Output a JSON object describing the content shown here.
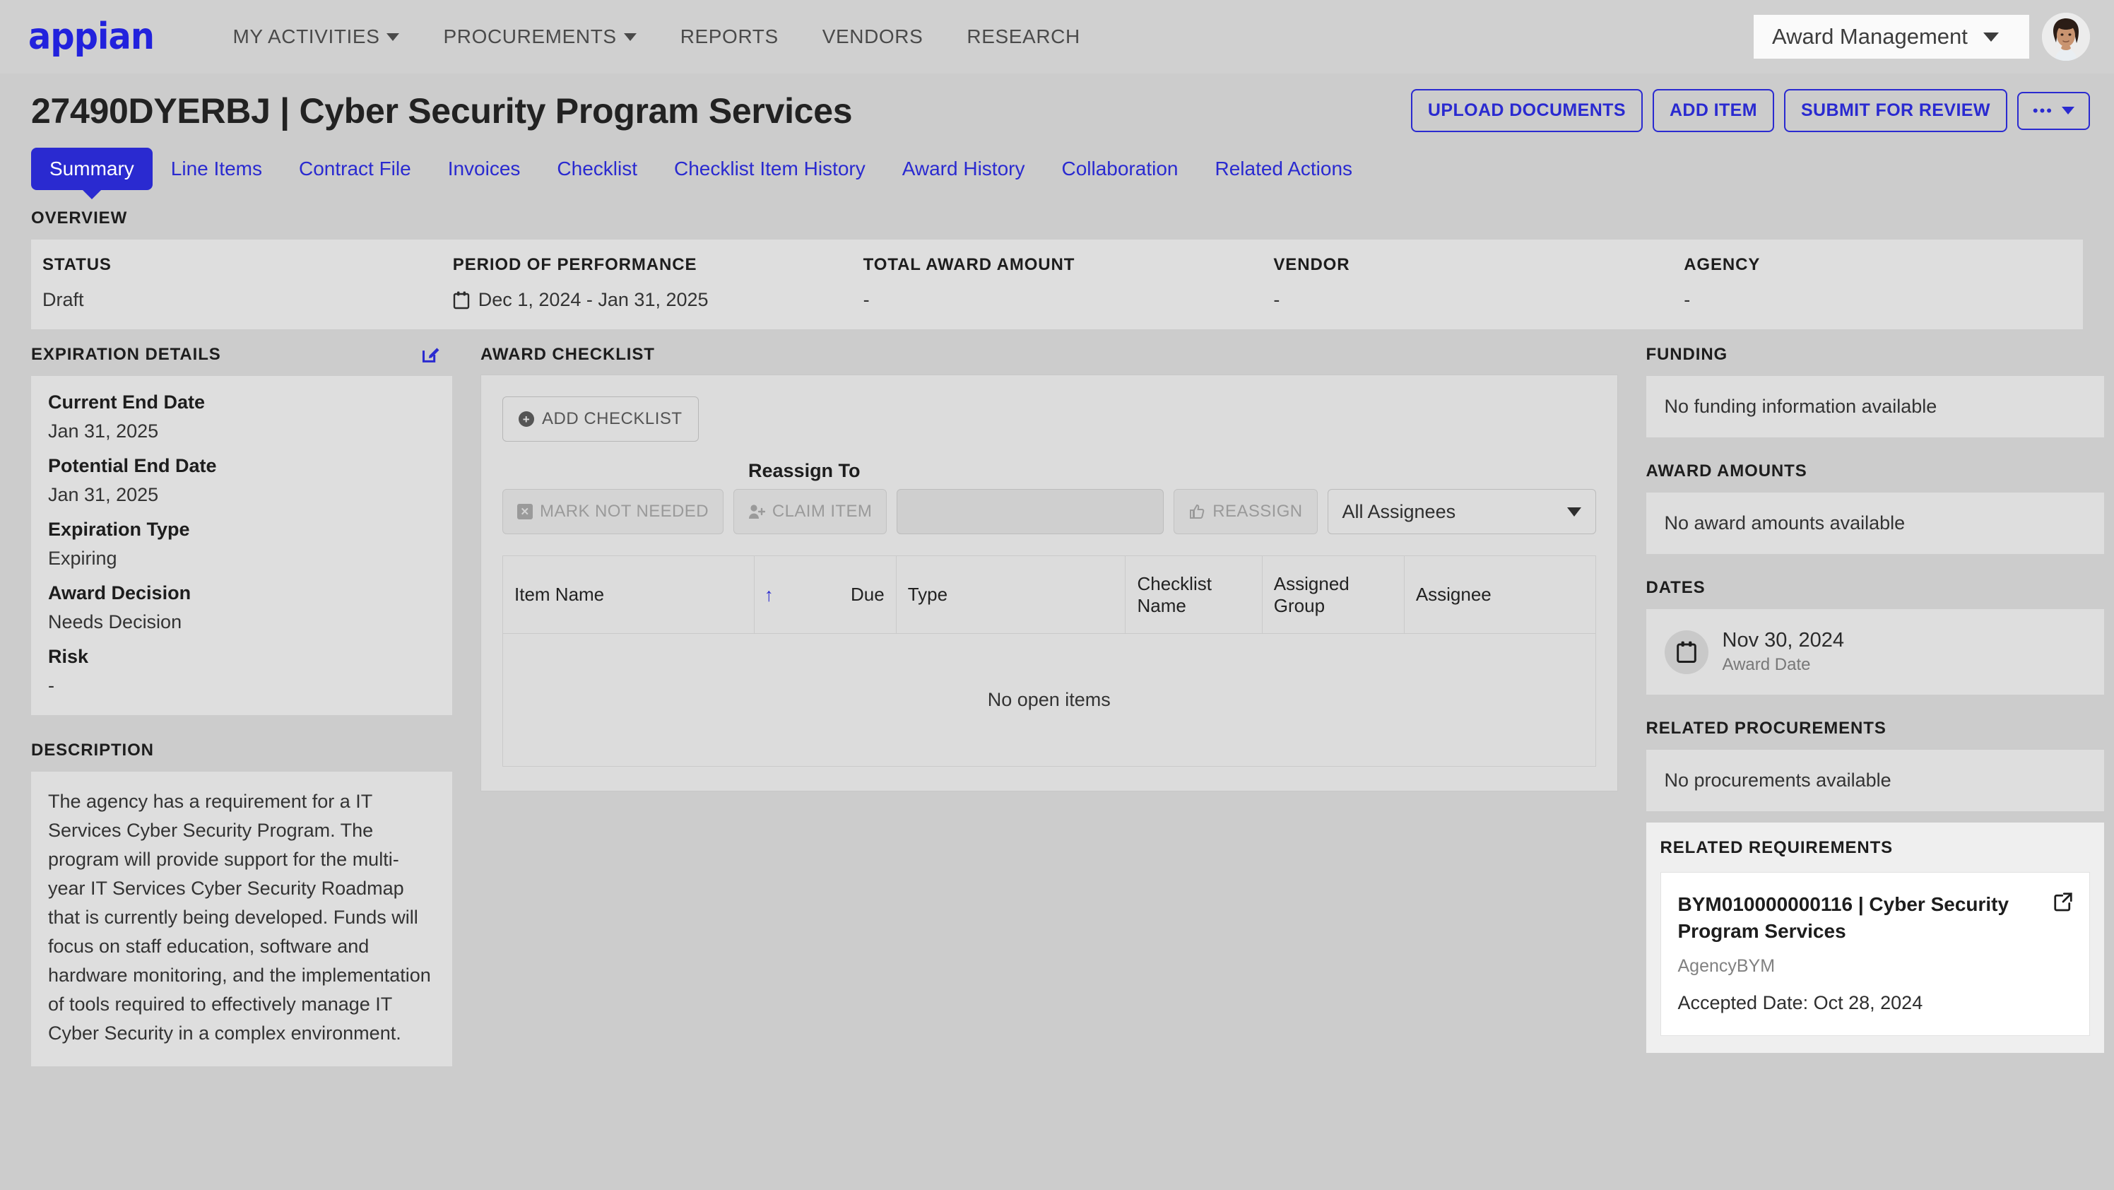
{
  "topnav": {
    "logo_text": "appian",
    "items": [
      {
        "label": "MY ACTIVITIES",
        "has_caret": true
      },
      {
        "label": "PROCUREMENTS",
        "has_caret": true
      },
      {
        "label": "REPORTS",
        "has_caret": false
      },
      {
        "label": "VENDORS",
        "has_caret": false
      },
      {
        "label": "RESEARCH",
        "has_caret": false
      }
    ],
    "context_selector": "Award Management"
  },
  "page": {
    "title": "27490DYERBJ | Cyber Security Program Services",
    "actions": [
      {
        "label": "UPLOAD DOCUMENTS"
      },
      {
        "label": "ADD ITEM"
      },
      {
        "label": "SUBMIT FOR REVIEW"
      }
    ],
    "kebab_label": "•••"
  },
  "tabs": [
    {
      "label": "Summary",
      "active": true
    },
    {
      "label": "Line Items",
      "active": false
    },
    {
      "label": "Contract File",
      "active": false
    },
    {
      "label": "Invoices",
      "active": false
    },
    {
      "label": "Checklist",
      "active": false
    },
    {
      "label": "Checklist Item History",
      "active": false
    },
    {
      "label": "Award History",
      "active": false
    },
    {
      "label": "Collaboration",
      "active": false
    },
    {
      "label": "Related Actions",
      "active": false
    }
  ],
  "overview": {
    "section_label": "OVERVIEW",
    "columns": [
      {
        "header": "STATUS",
        "value": "Draft",
        "icon": null
      },
      {
        "header": "PERIOD OF PERFORMANCE",
        "value": "Dec 1, 2024 - Jan 31, 2025",
        "icon": "calendar-icon"
      },
      {
        "header": "TOTAL AWARD AMOUNT",
        "value": "-",
        "icon": null
      },
      {
        "header": "VENDOR",
        "value": "-",
        "icon": null
      },
      {
        "header": "AGENCY",
        "value": "-",
        "icon": null
      }
    ]
  },
  "expiration": {
    "section_label": "EXPIRATION DETAILS",
    "edit_icon": "edit-pencil-icon",
    "fields": [
      {
        "label": "Current End Date",
        "value": "Jan 31, 2025"
      },
      {
        "label": "Potential End Date",
        "value": "Jan 31, 2025"
      },
      {
        "label": "Expiration Type",
        "value": "Expiring"
      },
      {
        "label": "Award Decision",
        "value": "Needs Decision"
      },
      {
        "label": "Risk",
        "value": "-"
      }
    ]
  },
  "description": {
    "section_label": "DESCRIPTION",
    "text": "The agency has a requirement for a IT Services Cyber Security Program. The program will provide support for the multi-year IT Services Cyber Security Roadmap that is currently being developed. Funds will focus on staff education, software and hardware monitoring, and the implementation of tools required to effectively manage IT Cyber Security in a complex environment."
  },
  "checklist": {
    "section_label": "AWARD CHECKLIST",
    "add_button": "ADD CHECKLIST",
    "reassign_label": "Reassign To",
    "reassign_input_value": "",
    "reassign_input_placeholder": "",
    "buttons": [
      {
        "label": "MARK NOT NEEDED",
        "icon": "x-square-icon",
        "disabled": true
      },
      {
        "label": "CLAIM ITEM",
        "icon": "user-add-icon",
        "disabled": true
      },
      {
        "label": "REASSIGN",
        "icon": "thumb-icon",
        "disabled": true
      }
    ],
    "assignee_filter": "All Assignees",
    "table": {
      "headers": [
        "Item Name",
        "Due",
        "Type",
        "Checklist Name",
        "Assigned Group",
        "Assignee"
      ],
      "sort_column": "Due",
      "sort_direction": "asc",
      "rows": [],
      "empty_message": "No open items"
    }
  },
  "rail": {
    "funding": {
      "label": "FUNDING",
      "empty": "No funding information available"
    },
    "award_amounts": {
      "label": "AWARD AMOUNTS",
      "empty": "No award amounts available"
    },
    "dates": {
      "label": "DATES",
      "items": [
        {
          "icon": "calendar-icon",
          "date": "Nov 30, 2024",
          "caption": "Award Date"
        }
      ]
    },
    "related_procurements": {
      "label": "RELATED PROCUREMENTS",
      "empty": "No procurements available"
    },
    "related_requirements": {
      "label": "RELATED REQUIREMENTS",
      "cards": [
        {
          "title": "BYM010000000116 | Cyber Security Program Services",
          "agency": "AgencyBYM",
          "accepted": "Accepted Date: Oct 28, 2024",
          "link_icon": "external-link-icon"
        }
      ]
    }
  },
  "colors": {
    "brand_blue": "#2a2ad0",
    "page_bg": "#cccccc",
    "panel_bg": "#dedede",
    "header_bg": "#d0d0d0"
  }
}
